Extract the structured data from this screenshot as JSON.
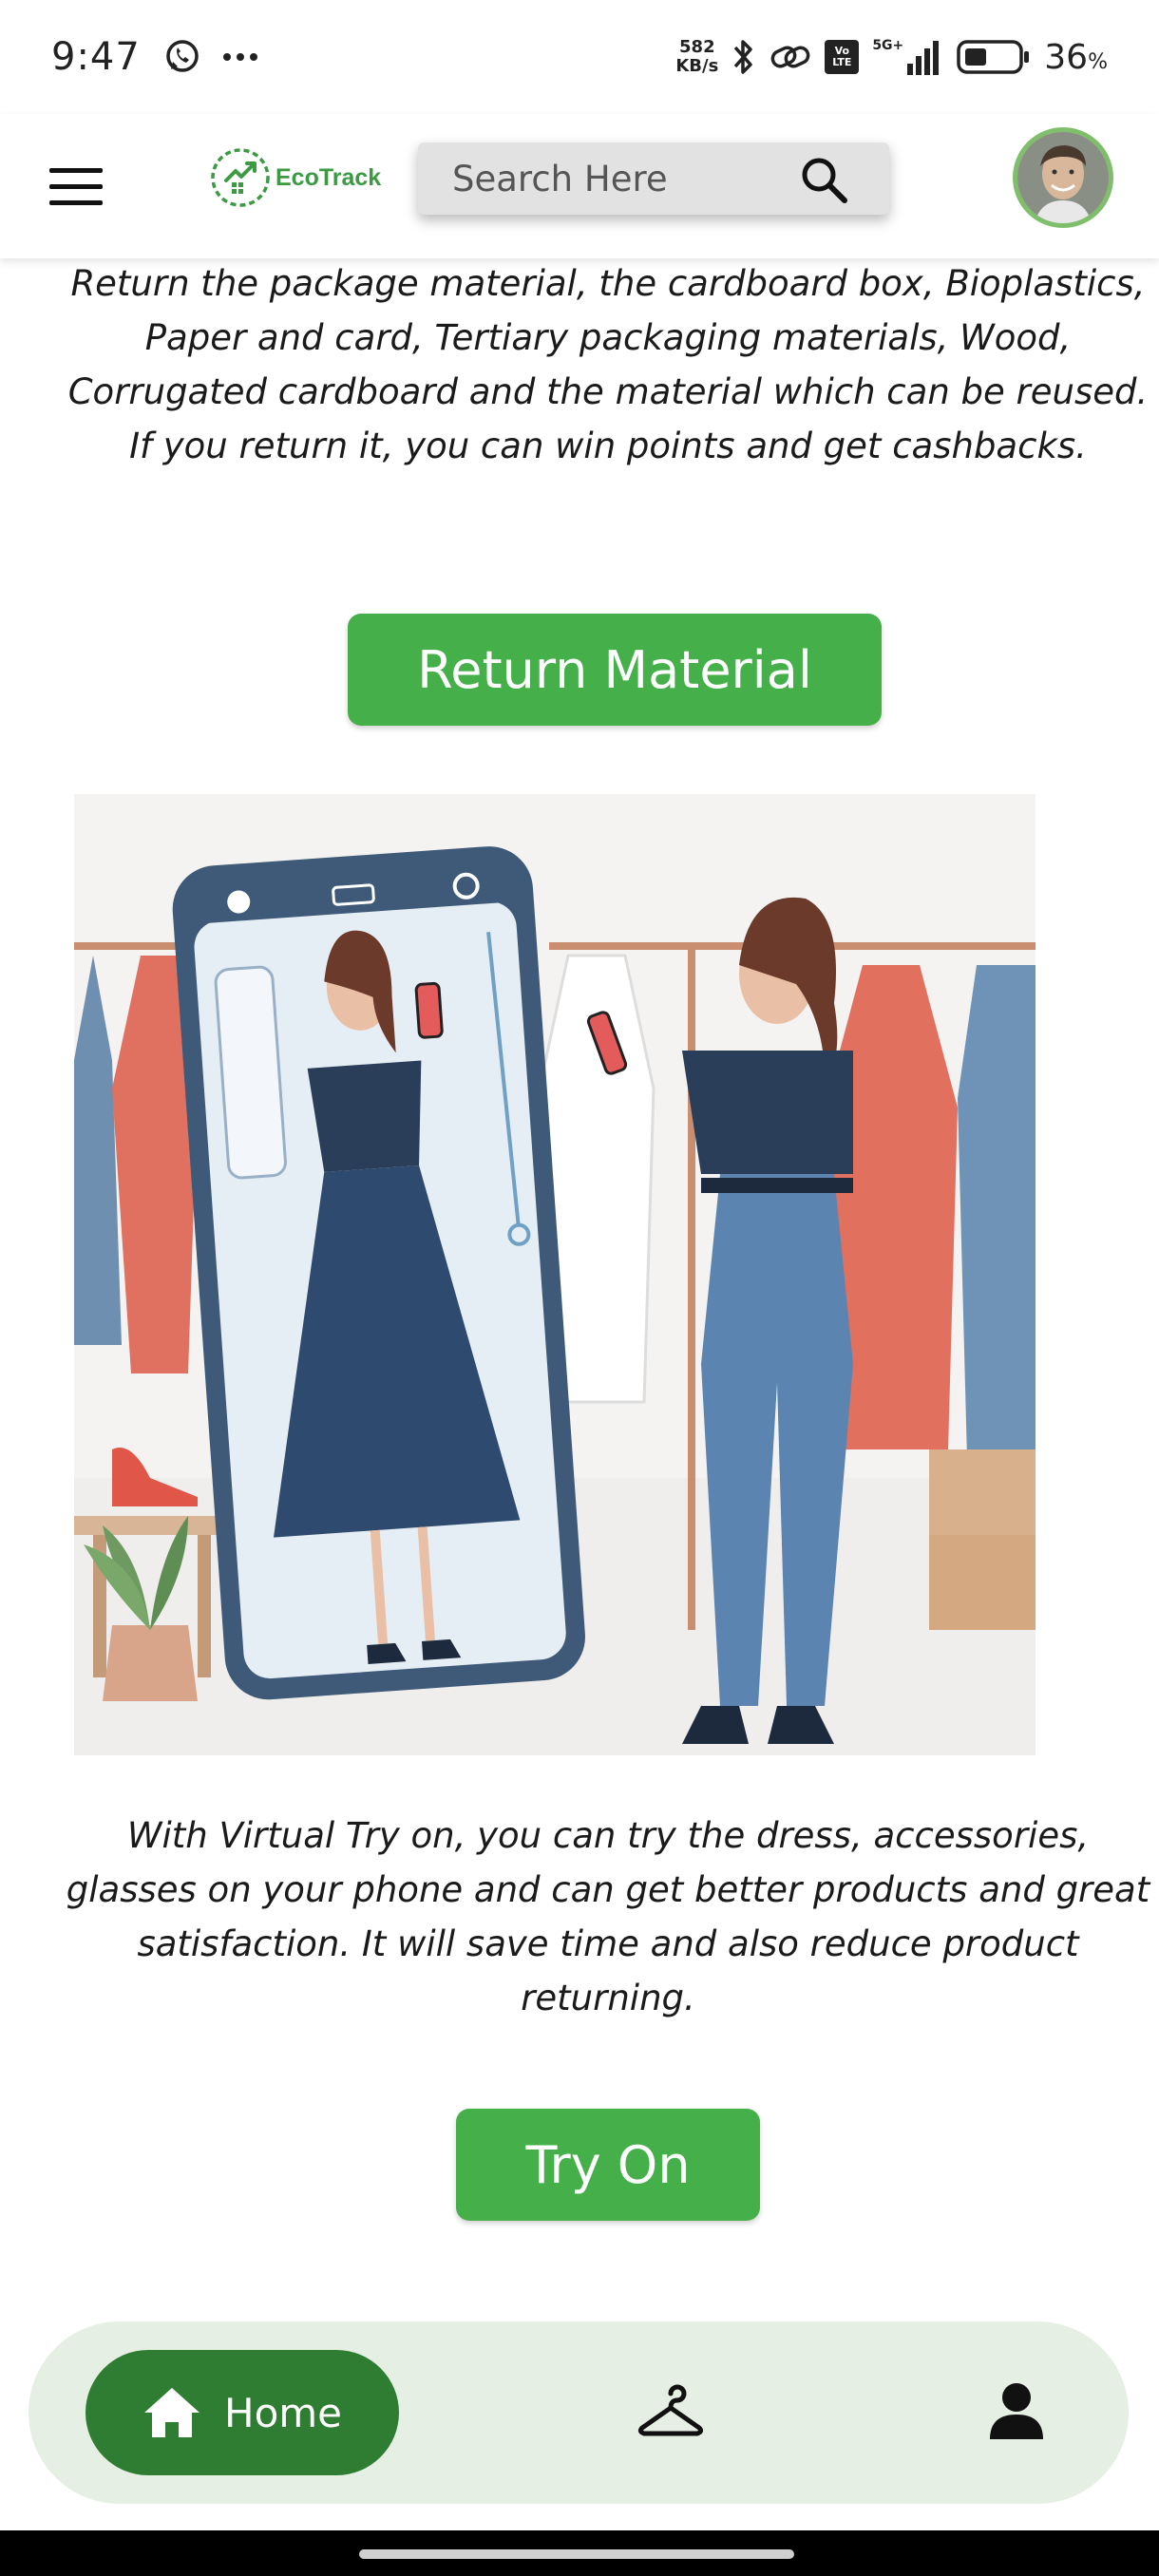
{
  "status_bar": {
    "time": "9:47",
    "net_speed_value": "582",
    "net_speed_unit": "KB/s",
    "volte_label": "Vo LTE",
    "network_label": "5G+",
    "battery_percent": "36",
    "battery_unit": "%"
  },
  "header": {
    "logo_text": "EcoTrack",
    "search_placeholder": "Search Here"
  },
  "main": {
    "return_description": "Return the package material, the cardboard box, Bioplastics, Paper and card, Tertiary packaging materials, Wood, Corrugated cardboard and the material which can be reused. If you return it, you can win points and get cashbacks.",
    "return_button_label": "Return Material",
    "tryon_description": "With Virtual Try on, you can try the dress, accessories, glasses on your phone and can get better products and great satisfaction. It will save time  and also reduce product returning.",
    "tryon_button_label": "Try On"
  },
  "bottom_nav": {
    "home_label": "Home"
  },
  "colors": {
    "accent_green": "#45b04a",
    "nav_active": "#2e7d32",
    "nav_bg": "#e6efe4",
    "logo_green": "#3c9a42"
  },
  "icons": {
    "menu": "hamburger-icon",
    "search": "search-icon",
    "home": "home-icon",
    "tryon": "hanger-icon",
    "profile": "person-icon"
  }
}
